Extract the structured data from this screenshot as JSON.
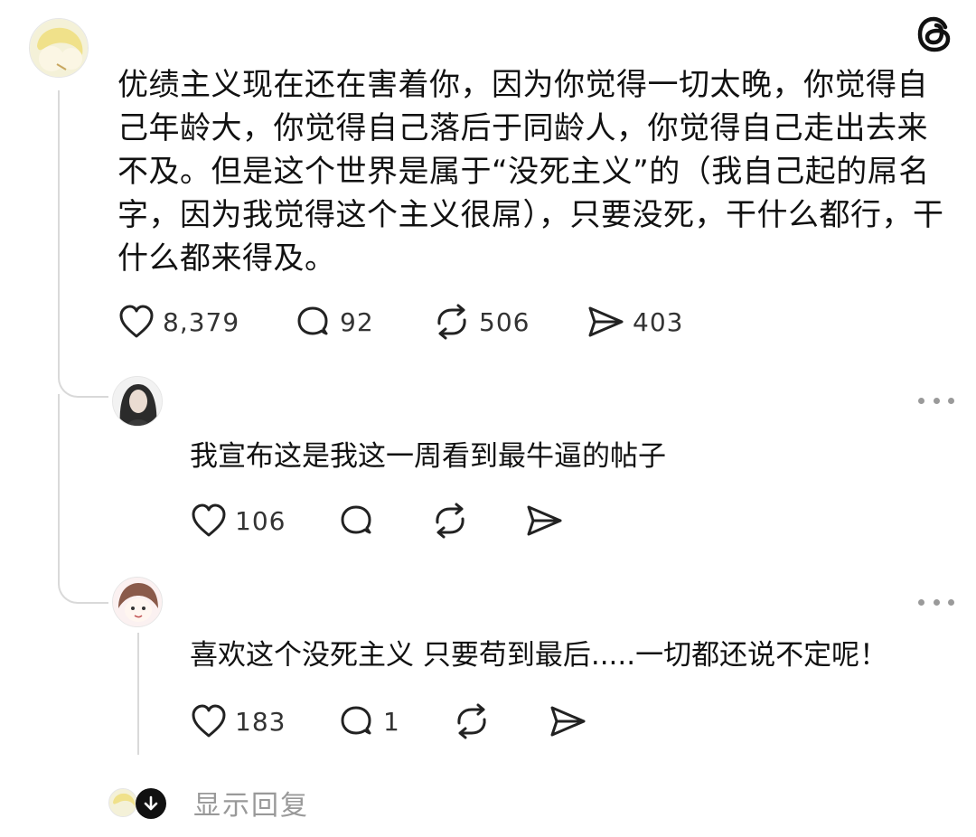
{
  "post": {
    "text": "优绩主义现在还在害着你，因为你觉得一切太晚，你觉得自己年龄大，你觉得自己落后于同龄人，你觉得自己走出去来不及。但是这个世界是属于“没死主义”的（我自己起的屌名字，因为我觉得这个主义很屌），只要没死，干什么都行，干什么都来得及。",
    "likes": "8,379",
    "comments": "92",
    "reposts": "506",
    "shares": "403"
  },
  "replies": [
    {
      "text": "我宣布这是我这一周看到最牛逼的帖子",
      "likes": "106",
      "comments": "",
      "reposts": "",
      "shares": ""
    },
    {
      "text": "喜欢这个没死主义 只要苟到最后.....一切都还说不定呢！",
      "likes": "183",
      "comments": "1",
      "reposts": "",
      "shares": ""
    }
  ],
  "footer": {
    "show_replies_label": "显示回复"
  },
  "icons": {
    "app_logo": "threads-logo-icon",
    "like": "heart-icon",
    "comment": "comment-bubble-icon",
    "repost": "repost-icon",
    "share": "send-icon",
    "more": "more-options-icon",
    "expand": "arrow-down-icon"
  },
  "colors": {
    "text": "#111111",
    "muted": "#999999",
    "thread_line": "#d9d9d9"
  }
}
